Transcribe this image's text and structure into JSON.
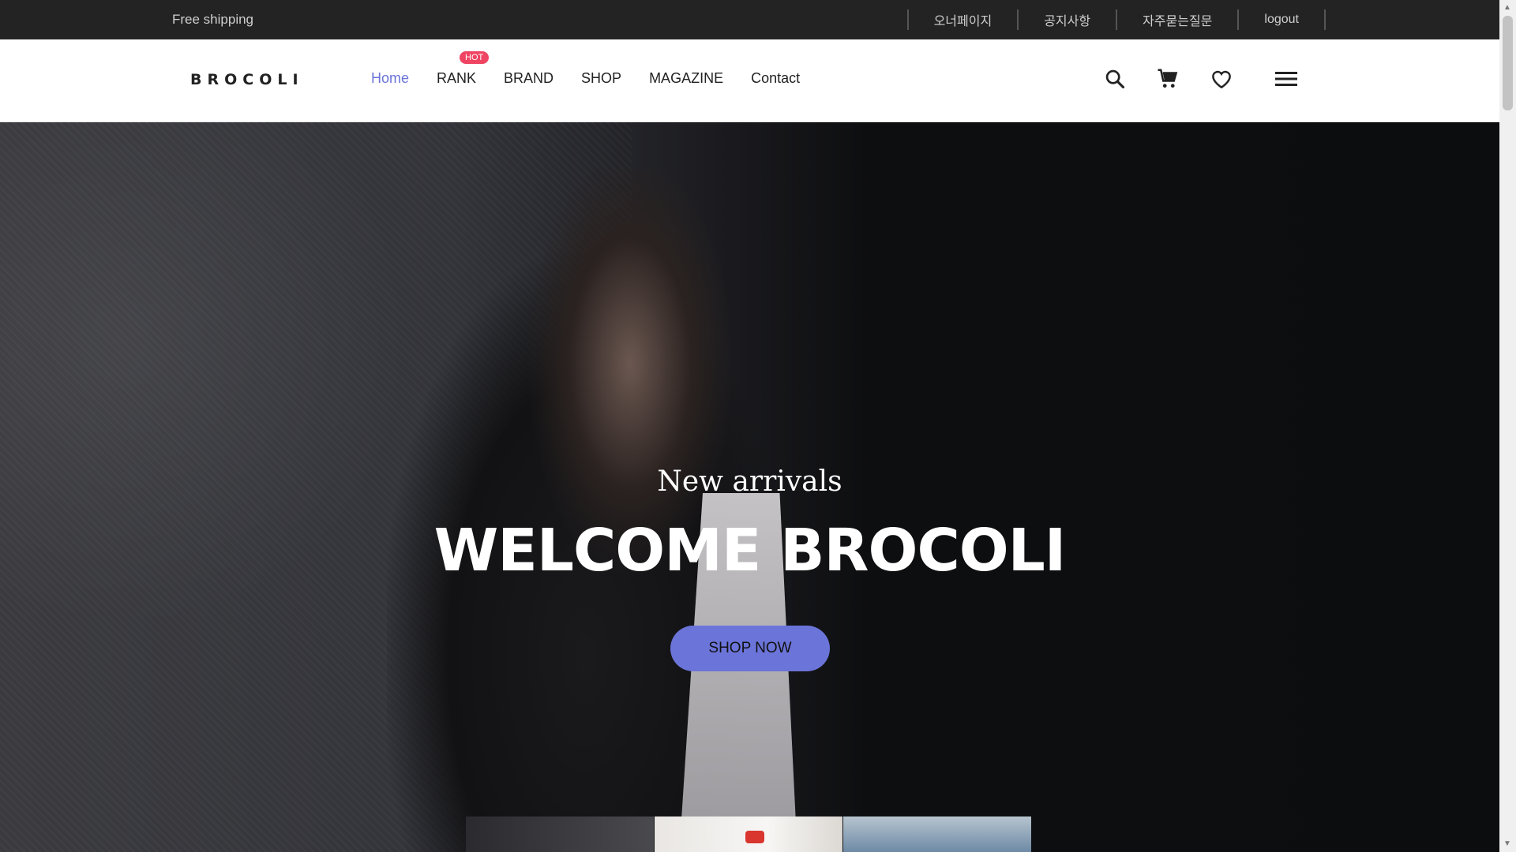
{
  "topbar": {
    "free_shipping": "Free shipping",
    "links": [
      "오너페이지",
      "공지사항",
      "자주묻는질문",
      "logout"
    ]
  },
  "header": {
    "logo": "BROCOLI",
    "nav": [
      "Home",
      "RANK",
      "BRAND",
      "SHOP",
      "MAGAZINE",
      "Contact"
    ],
    "hot_badge": "HOT",
    "icons": [
      "search-icon",
      "cart-icon",
      "heart-icon",
      "menu-icon"
    ]
  },
  "hero": {
    "subtitle": "New arrivals",
    "title": "WELCOME BROCOLI",
    "button": "SHOP NOW"
  },
  "colors": {
    "accent": "#6b74d9",
    "hot": "#ef4462",
    "topbar": "#232323"
  }
}
